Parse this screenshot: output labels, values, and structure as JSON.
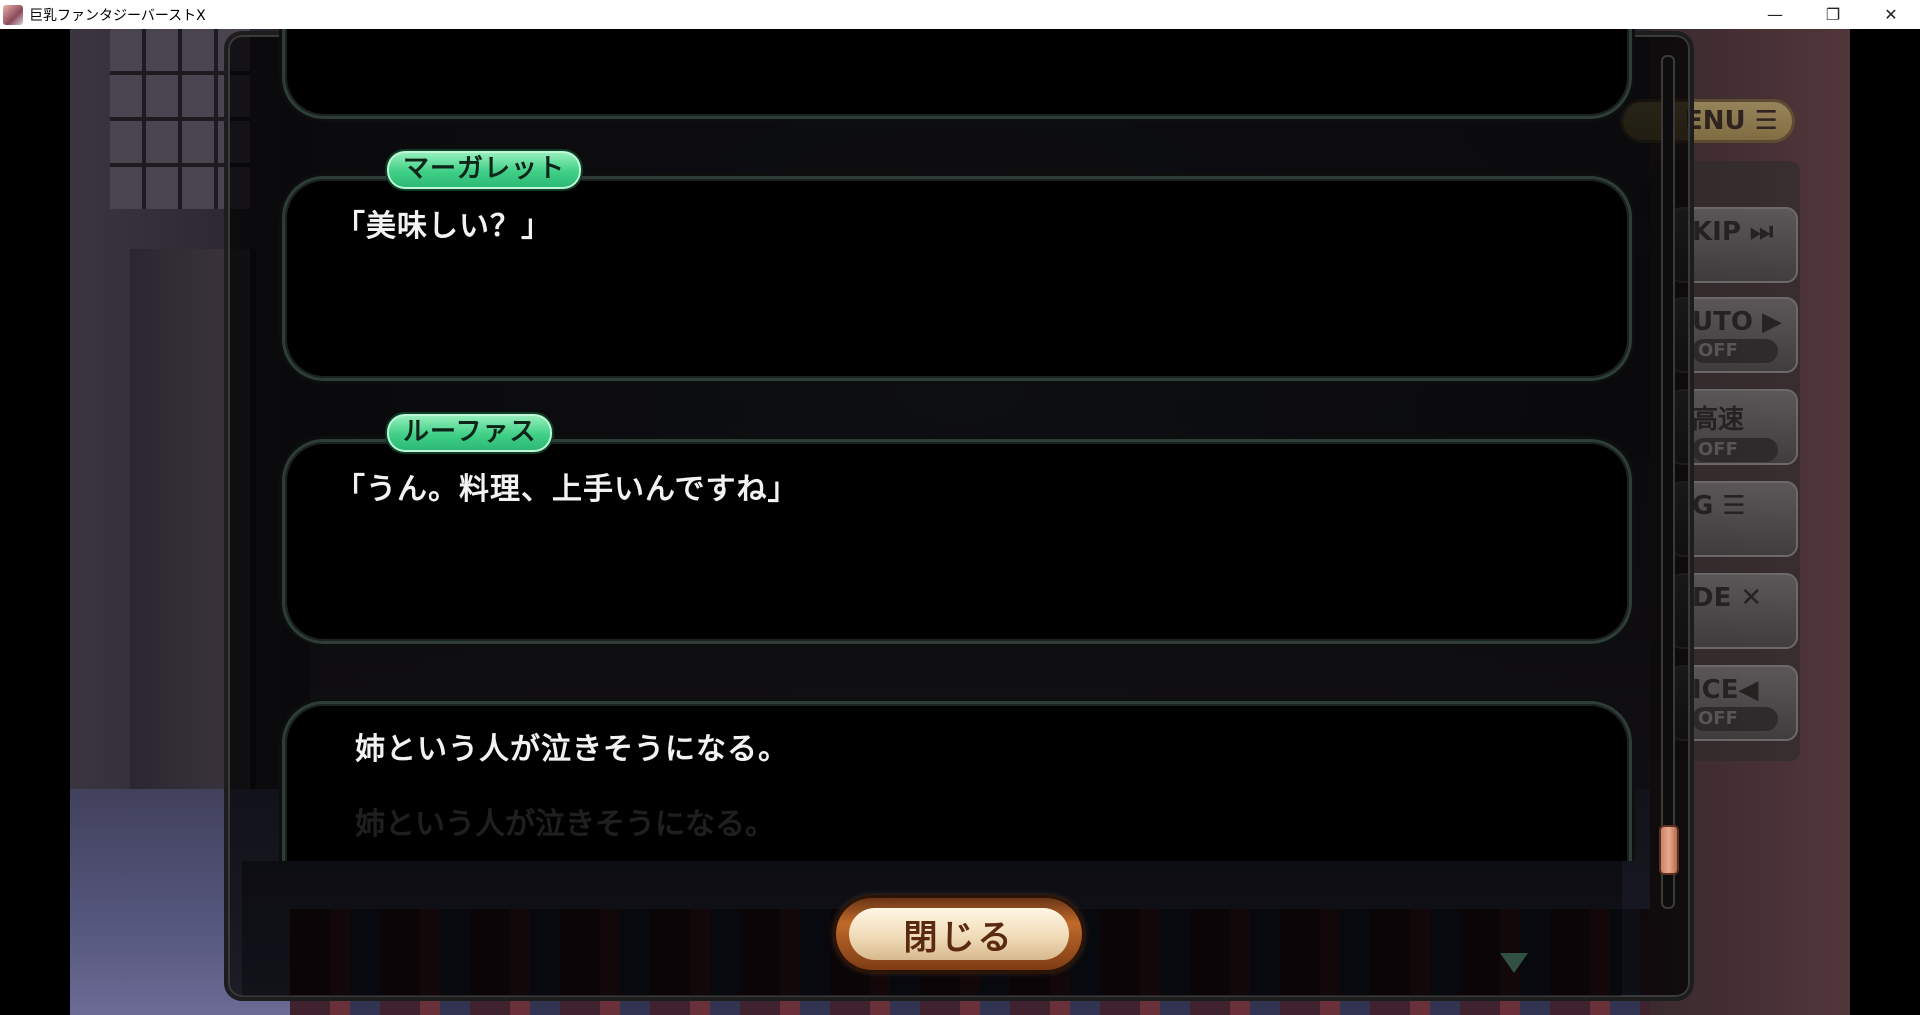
{
  "window": {
    "title": "巨乳ファンタジーバースト",
    "title_suffix": "X",
    "minimize_glyph": "—",
    "restore_glyph": "❐",
    "close_glyph": "✕"
  },
  "side_menu": {
    "menu_label": "ENU ☰",
    "buttons": [
      {
        "label": "KIP ⏭",
        "sub": ""
      },
      {
        "label": "UTO ▶",
        "sub": "OFF"
      },
      {
        "label": "高速",
        "sub": "OFF"
      },
      {
        "label": "G ☰",
        "sub": ""
      },
      {
        "label": "DE ✕",
        "sub": ""
      },
      {
        "label": "ICE◀",
        "sub": "OFF"
      }
    ]
  },
  "backlog": {
    "entries": [
      {
        "speaker": "",
        "text": ""
      },
      {
        "speaker": "マーガレット",
        "text": "「美味しい？」"
      },
      {
        "speaker": "ルーファス",
        "text": "「うん。料理、上手いんですね」"
      },
      {
        "speaker": "",
        "text": "姉という人が泣きそうになる。",
        "ghost": "姉という人が泣きそうになる。"
      }
    ],
    "scroll_position": 0.96
  },
  "close_button": {
    "label": "閉じる"
  },
  "colors": {
    "speaker_tag": "#3fcf86",
    "close_button_rim": "#c06a2a",
    "scroll_thumb": "#e8a98c"
  }
}
